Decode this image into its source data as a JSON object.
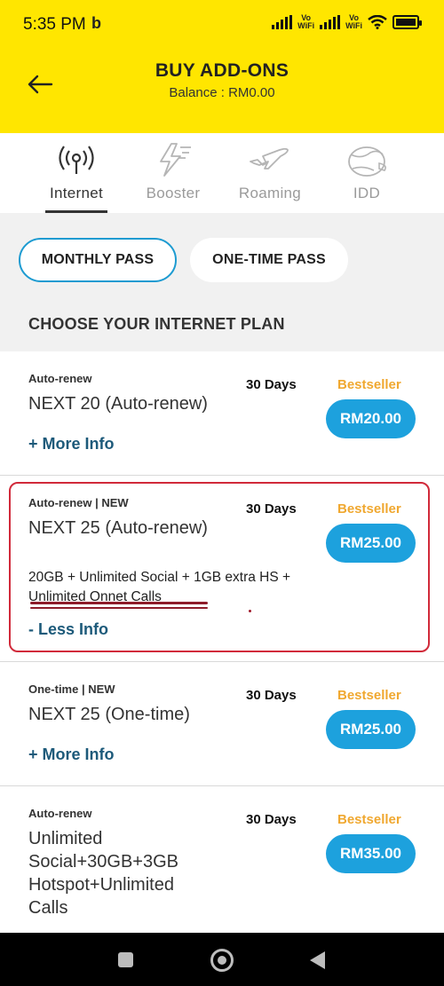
{
  "status": {
    "time": "5:35 PM",
    "app_glyph": "b",
    "vowifi1": "Vo\nWiFi",
    "vowifi2": "Vo\nWiFi"
  },
  "header": {
    "title": "BUY ADD-ONS",
    "balance": "Balance : RM0.00",
    "back_icon": "arrow-left-icon"
  },
  "categories": [
    {
      "label": "Internet",
      "icon": "antenna-icon",
      "active": true
    },
    {
      "label": "Booster",
      "icon": "lightning-icon",
      "active": false
    },
    {
      "label": "Roaming",
      "icon": "airplane-icon",
      "active": false
    },
    {
      "label": "IDD",
      "icon": "globe-phone-icon",
      "active": false
    }
  ],
  "pass_tabs": [
    {
      "label": "MONTHLY PASS",
      "active": true
    },
    {
      "label": "ONE-TIME PASS",
      "active": false
    }
  ],
  "section_title": "CHOOSE YOUR INTERNET PLAN",
  "plans": [
    {
      "tag": "Auto-renew",
      "name": "NEXT 20 (Auto-renew)",
      "days": "30 Days",
      "badge": "Bestseller",
      "price": "RM20.00",
      "info": "+ More Info"
    },
    {
      "tag": "Auto-renew | NEW",
      "name": "NEXT 25 (Auto-renew)",
      "days": "30 Days",
      "badge": "Bestseller",
      "price": "RM25.00",
      "desc": "20GB + Unlimited Social + 1GB extra HS + Unlimited Onnet Calls",
      "info": "- Less Info"
    },
    {
      "tag": "One-time | NEW",
      "name": "NEXT 25 (One-time)",
      "days": "30 Days",
      "badge": "Bestseller",
      "price": "RM25.00",
      "info": "+ More Info"
    },
    {
      "tag": "Auto-renew",
      "name": "Unlimited Social+30GB+3GB Hotspot+Unlimited Calls",
      "days": "30 Days",
      "badge": "Bestseller",
      "price": "RM35.00"
    }
  ],
  "colors": {
    "header_bg": "#ffe600",
    "accent_blue": "#1da1dd",
    "bestseller": "#f0a830",
    "info_link": "#1d5a7a",
    "highlight_border": "#d12a3a"
  },
  "navbar": {
    "icons": [
      "recent-apps-icon",
      "home-icon",
      "back-triangle-icon"
    ]
  }
}
